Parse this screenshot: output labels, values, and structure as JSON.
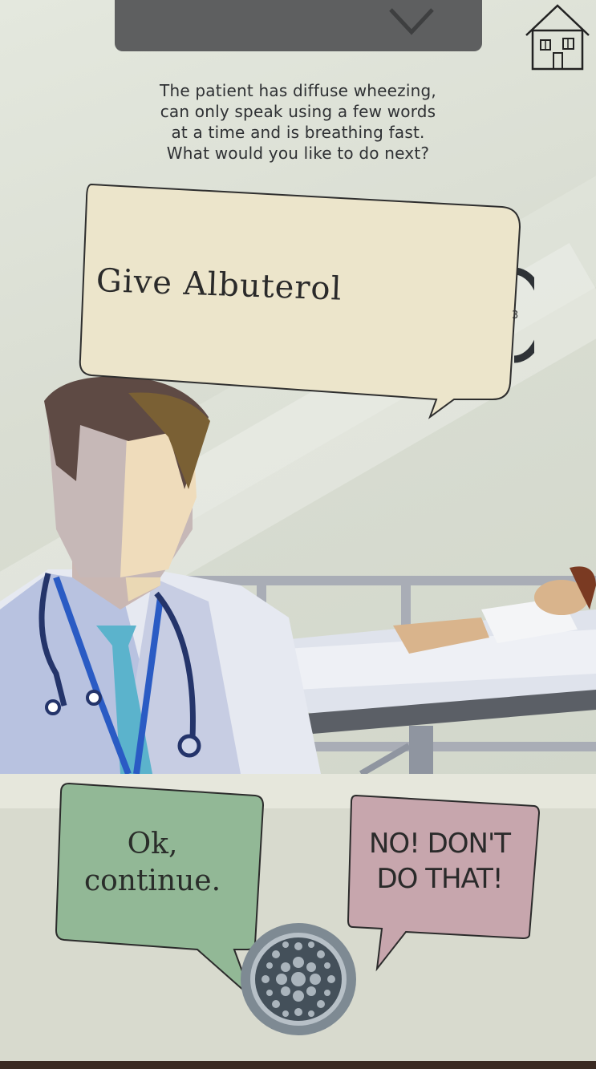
{
  "prompt": {
    "line1": "The patient has diffuse wheezing,",
    "line2": "can only speak using a few words",
    "line3": "at a time and is breathing fast.",
    "line4": "What would you like to do next?"
  },
  "option": {
    "label": "Give Albuterol",
    "counter": "3"
  },
  "responses": {
    "accept_line1": "Ok,",
    "accept_line2": "continue.",
    "reject_line1": "NO! DON'T",
    "reject_line2": "DO THAT!"
  },
  "icons": {
    "menu": "chevron-down-icon",
    "home": "house-icon",
    "speaker": "speaker-grille-icon"
  },
  "colors": {
    "accept_bubble": "#92b896",
    "reject_bubble": "#c7a6ad",
    "option_bubble": "#ece5cb",
    "menu_bar": "#5e5f60"
  }
}
